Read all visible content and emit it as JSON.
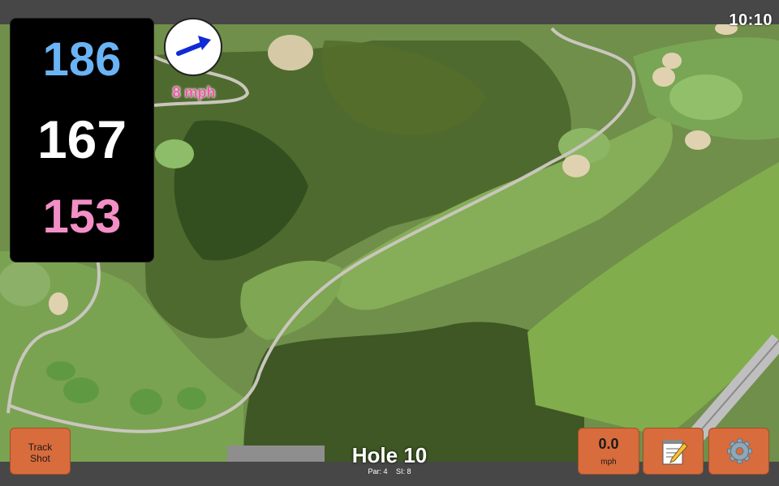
{
  "status": {
    "time": "10:10"
  },
  "yardages": {
    "back": "186",
    "middle": "167",
    "front": "153"
  },
  "wind": {
    "speed": "8 mph",
    "icon": "wind-arrow-icon"
  },
  "hole": {
    "title": "Hole 10",
    "par": "Par: 4",
    "stroke_index": "SI: 8"
  },
  "buttons": {
    "track_shot_line1": "Track",
    "track_shot_line2": "Shot",
    "speed_value": "0.0",
    "speed_unit": "mph",
    "notes_icon": "notepad-icon",
    "settings_icon": "gear-icon"
  },
  "colors": {
    "back": "#6ab3f5",
    "middle": "#ffffff",
    "front": "#f38fc6",
    "button": "#d86c3c",
    "wind_text": "#f25aa8"
  }
}
